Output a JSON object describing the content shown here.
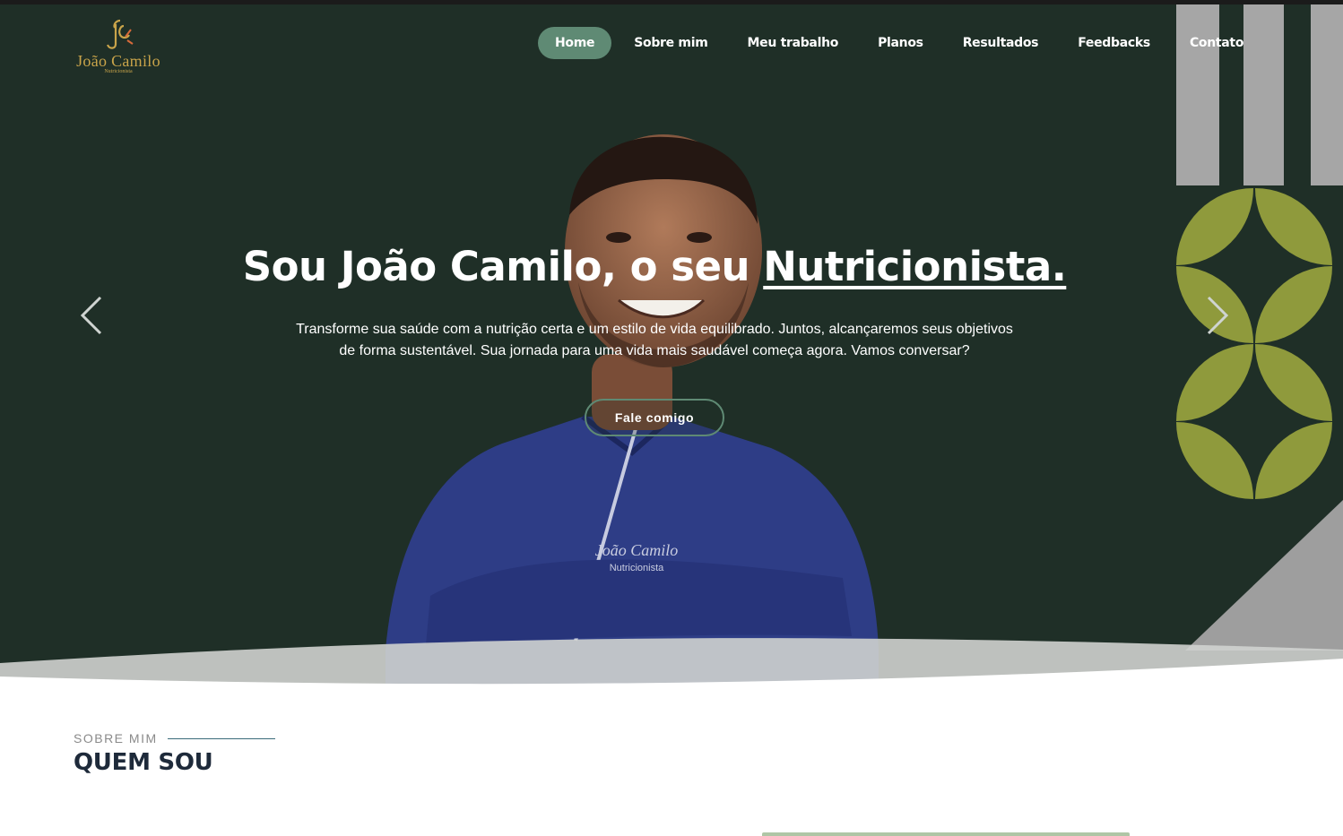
{
  "brand": {
    "name": "João Camilo",
    "subtitle": "Nutricionista",
    "logo_icon": "jc-monogram-icon",
    "gold": "#c9a44a"
  },
  "nav": {
    "items": [
      {
        "label": "Home",
        "active": true
      },
      {
        "label": "Sobre mim",
        "active": false
      },
      {
        "label": "Meu trabalho",
        "active": false
      },
      {
        "label": "Planos",
        "active": false
      },
      {
        "label": "Resultados",
        "active": false
      },
      {
        "label": "Feedbacks",
        "active": false
      },
      {
        "label": "Contato",
        "active": false
      }
    ],
    "active_color": "#5f8a74"
  },
  "hero": {
    "headline_prefix": "Sou João Camilo, o seu ",
    "headline_highlight": "Nutricionista.",
    "description": "Transforme sua saúde com a nutrição certa e um estilo de vida equilibrado. Juntos, alcançaremos seus objetivos de forma sustentável. Sua jornada para uma vida mais saudável começa agora. Vamos conversar?",
    "cta_label": "Fale comigo",
    "prev_icon": "chevron-left-icon",
    "next_icon": "chevron-right-icon",
    "background": "#1f2f27",
    "shirt_text": "João Camilo",
    "shirt_subtext": "Nutricionista"
  },
  "about": {
    "eyebrow": "SOBRE MIM",
    "title": "QUEM SOU"
  }
}
